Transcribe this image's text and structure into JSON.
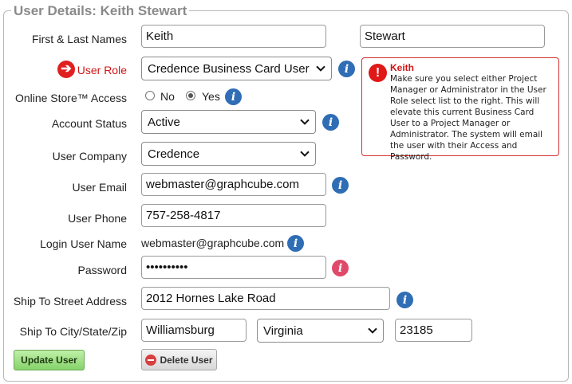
{
  "legend": "User Details: Keith Stewart",
  "labels": {
    "names": "First & Last Names",
    "role": "User Role",
    "store": "Online Store™ Access",
    "status": "Account Status",
    "company": "User Company",
    "email": "User Email",
    "phone": "User Phone",
    "login": "Login User Name",
    "password": "Password",
    "street": "Ship To Street Address",
    "city": "Ship To City/State/Zip"
  },
  "fields": {
    "first_name": "Keith",
    "last_name": "Stewart",
    "role": "Credence Business Card User",
    "store_no": "No",
    "store_yes": "Yes",
    "status": "Active",
    "company": "Credence",
    "email": "webmaster@graphcube.com",
    "phone": "757-258-4817",
    "login": "webmaster@graphcube.com",
    "password": "••••••••••",
    "street": "2012 Hornes Lake Road",
    "city": "Williamsburg",
    "state": "Virginia",
    "zip": "23185"
  },
  "alert": {
    "name": "Keith",
    "message": "Make sure you select either Project Manager or Administrator in the User Role select list to the right. This will elevate this current Business Card User to a Project Manager or Administrator. The system will email the user with their Access and Password."
  },
  "buttons": {
    "update": "Update User",
    "delete": "Delete User"
  },
  "icons": {
    "info": "info-icon",
    "arrow": "arrow-right-icon",
    "alert": "exclamation-icon",
    "delete": "minus-circle-icon",
    "chevron": "chevron-down-icon"
  },
  "colors": {
    "required": "#d21414",
    "info": "#2f6db5",
    "update_button": "#86d36a"
  }
}
